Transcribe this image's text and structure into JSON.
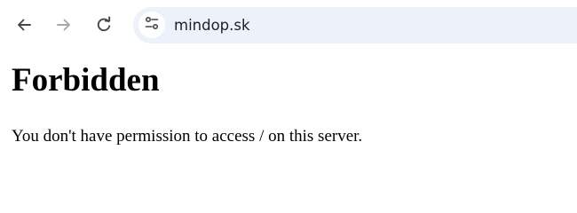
{
  "browser": {
    "nav": {
      "back_icon": "arrow-left-icon",
      "forward_icon": "arrow-right-icon",
      "forward_enabled": false,
      "reload_icon": "reload-icon"
    },
    "omnibox": {
      "site_info_icon": "tune-icon",
      "url": "mindop.sk",
      "background_color": "#edf2fa"
    }
  },
  "page": {
    "heading": "Forbidden",
    "message": "You don't have permission to access / on this server."
  }
}
